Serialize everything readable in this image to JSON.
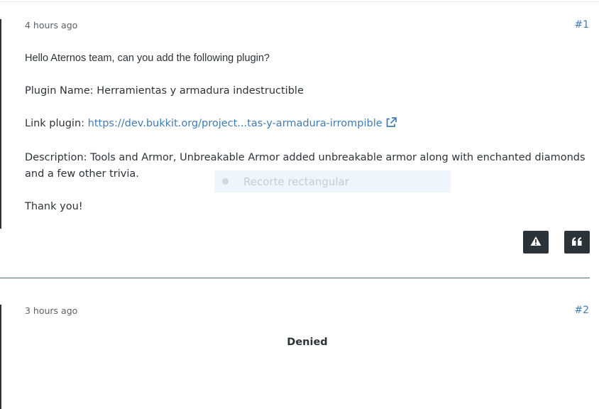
{
  "posts": [
    {
      "timestamp": "4 hours ago",
      "number": "#1",
      "greeting": "Hello Aternos team, can you add the following plugin?",
      "plugin_name_line": "Plugin Name: Herramientas y armadura indestructible",
      "link_label": "Link plugin: ",
      "link_text": "https://dev.bukkit.org/project...tas-y-armadura-irrompible",
      "description": "Description: Tools and Armor, Unbreakable Armor added unbreakable armor along with enchanted diamonds and a few other trivia.",
      "thanks": "Thank you!",
      "actions": {
        "report_icon": "warning-triangle-icon",
        "quote_icon": "quote-icon"
      }
    },
    {
      "timestamp": "3 hours ago",
      "number": "#2",
      "body": "Denied"
    }
  ],
  "overlay": {
    "label": "Recorte rectangular"
  },
  "colors": {
    "text": "#2c3338",
    "link": "#3f7cb4",
    "button_bg": "#2c3338",
    "separator": "#4b6a80"
  }
}
